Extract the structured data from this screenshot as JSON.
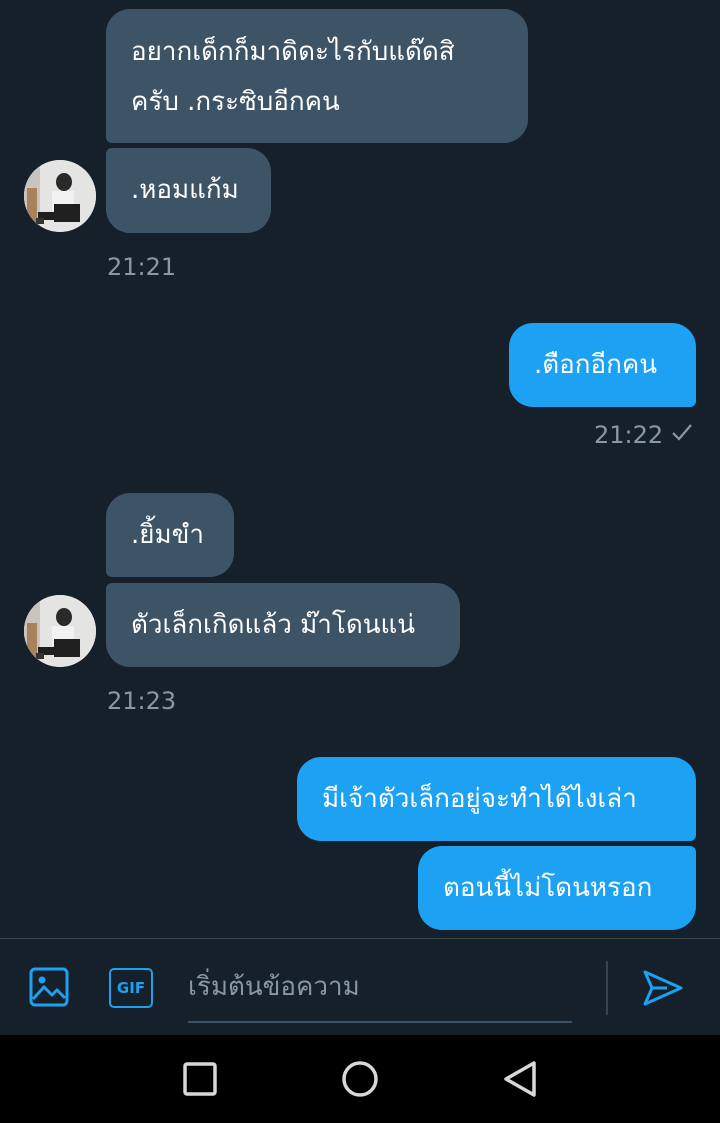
{
  "messages": [
    {
      "text_lines": [
        "อยากเด็กก็มาดิดะไรกับแด๊ดสิ",
        "ครับ .กระซิบอีกคน"
      ],
      "direction": "incoming"
    },
    {
      "text": ".หอมแก้ม",
      "direction": "incoming"
    },
    {
      "timestamp": "21:21"
    },
    {
      "text": ".ตือกอีกคน",
      "direction": "outgoing"
    },
    {
      "timestamp": "21:22",
      "status_icon": "check-icon"
    },
    {
      "text": ".ยิ้มขำ",
      "direction": "incoming"
    },
    {
      "text": "ตัวเล็กเกิดแล้ว ม๊าโดนแน่",
      "direction": "incoming"
    },
    {
      "timestamp": "21:23"
    },
    {
      "text": "มีเจ้าตัวเล็กอยู่จะทำได้ไงเล่า",
      "direction": "outgoing"
    },
    {
      "text": "ตอนนี้ไม่โดนหรอก",
      "direction": "outgoing"
    }
  ],
  "composer": {
    "placeholder": "เริ่มต้นข้อความ",
    "gif_label": "GIF",
    "icons": [
      "image-icon",
      "gif-icon",
      "send-icon"
    ]
  },
  "nav": {
    "icons": [
      "recents-icon",
      "home-icon",
      "back-icon"
    ]
  },
  "colors": {
    "background": "#15202b",
    "incoming_bubble": "#3d5466",
    "outgoing_bubble": "#1da1f2",
    "accent": "#1da1f2",
    "muted_text": "#8899a6"
  }
}
